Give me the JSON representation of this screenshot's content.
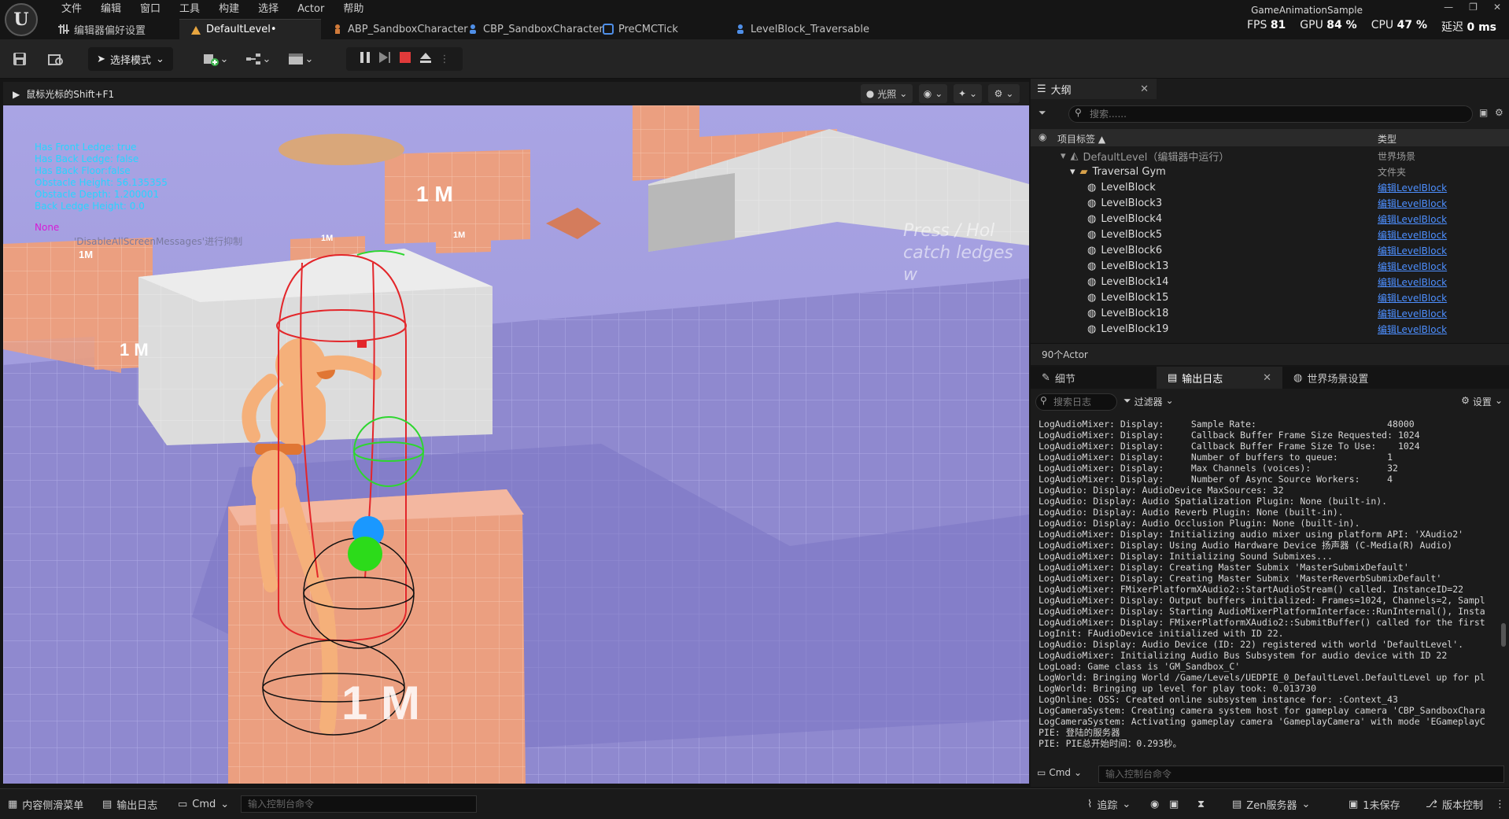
{
  "app": {
    "project_name": "GameAnimationSample"
  },
  "menu": [
    "文件",
    "编辑",
    "窗口",
    "工具",
    "构建",
    "选择",
    "Actor",
    "帮助"
  ],
  "tabs": [
    {
      "label": "编辑器偏好设置",
      "icon": "sliders-icon"
    },
    {
      "label": "DefaultLevel•",
      "icon": "level-icon",
      "active": true
    },
    {
      "label": "ABP_SandboxCharacter",
      "icon": "anim-blueprint-icon"
    },
    {
      "label": "CBP_SandboxCharacter",
      "icon": "character-icon"
    },
    {
      "label": "PreCMCTick",
      "icon": "blueprint-icon"
    },
    {
      "label": "LevelBlock_Traversable",
      "icon": "actor-icon"
    }
  ],
  "perf": {
    "fps_label": "FPS",
    "fps": "81",
    "gpu_label": "GPU",
    "gpu": "84 %",
    "cpu_label": "CPU",
    "cpu": "47 %",
    "latency_label": "延迟",
    "latency": "0 ms"
  },
  "toolbar": {
    "mode_label": "选择模式"
  },
  "viewport": {
    "hint": "鼠标光标的Shift+F1",
    "lit_label": "光照",
    "debug_lines": [
      "Has Front Ledge: true",
      "Has Back Ledge: false",
      "Has Back Floor:false",
      "Obstacle Height: 56.135355",
      "Obstacle Depth: 1.200001",
      "Back Ledge Height: 0.0"
    ],
    "none_label": "None",
    "suppress_msg": "'DisableAllScreenMessages'进行抑制",
    "wall_text_1": "Press / Hol",
    "wall_text_2": "catch ledges w",
    "block_label": "1 M",
    "block_label_small": "1M"
  },
  "outliner": {
    "tab_label": "大纲",
    "search_placeholder": "搜索......",
    "col_label": "项目标签 ▲",
    "col_type": "类型",
    "rows": [
      {
        "label": "DefaultLevel（编辑器中运行）",
        "type": "世界场景",
        "indent": 1,
        "kind": "level"
      },
      {
        "label": "Traversal Gym",
        "type": "文件夹",
        "indent": 2,
        "kind": "folder"
      },
      {
        "label": "LevelBlock",
        "type": "编辑LevelBlock",
        "indent": 3,
        "kind": "actor"
      },
      {
        "label": "LevelBlock3",
        "type": "编辑LevelBlock",
        "indent": 3,
        "kind": "actor"
      },
      {
        "label": "LevelBlock4",
        "type": "编辑LevelBlock",
        "indent": 3,
        "kind": "actor"
      },
      {
        "label": "LevelBlock5",
        "type": "编辑LevelBlock",
        "indent": 3,
        "kind": "actor"
      },
      {
        "label": "LevelBlock6",
        "type": "编辑LevelBlock",
        "indent": 3,
        "kind": "actor"
      },
      {
        "label": "LevelBlock13",
        "type": "编辑LevelBlock",
        "indent": 3,
        "kind": "actor"
      },
      {
        "label": "LevelBlock14",
        "type": "编辑LevelBlock",
        "indent": 3,
        "kind": "actor"
      },
      {
        "label": "LevelBlock15",
        "type": "编辑LevelBlock",
        "indent": 3,
        "kind": "actor"
      },
      {
        "label": "LevelBlock18",
        "type": "编辑LevelBlock",
        "indent": 3,
        "kind": "actor"
      },
      {
        "label": "LevelBlock19",
        "type": "编辑LevelBlock",
        "indent": 3,
        "kind": "actor"
      }
    ],
    "actor_count": "90个Actor"
  },
  "lower_tabs": [
    {
      "label": "细节",
      "icon": "pencil-icon"
    },
    {
      "label": "输出日志",
      "icon": "log-icon",
      "active": true
    },
    {
      "label": "世界场景设置",
      "icon": "globe-icon"
    }
  ],
  "log": {
    "search_placeholder": "搜索日志",
    "filters_label": "过滤器",
    "settings_label": "设置",
    "lines": [
      "LogAudioMixer: Display:     Sample Rate:                        48000",
      "LogAudioMixer: Display:     Callback Buffer Frame Size Requested: 1024",
      "LogAudioMixer: Display:     Callback Buffer Frame Size To Use:    1024",
      "LogAudioMixer: Display:     Number of buffers to queue:         1",
      "LogAudioMixer: Display:     Max Channels (voices):              32",
      "LogAudioMixer: Display:     Number of Async Source Workers:     4",
      "LogAudio: Display: AudioDevice MaxSources: 32",
      "LogAudio: Display: Audio Spatialization Plugin: None (built-in).",
      "LogAudio: Display: Audio Reverb Plugin: None (built-in).",
      "LogAudio: Display: Audio Occlusion Plugin: None (built-in).",
      "LogAudioMixer: Display: Initializing audio mixer using platform API: 'XAudio2'",
      "LogAudioMixer: Display: Using Audio Hardware Device 扬声器 (C-Media(R) Audio)",
      "LogAudioMixer: Display: Initializing Sound Submixes...",
      "LogAudioMixer: Display: Creating Master Submix 'MasterSubmixDefault'",
      "LogAudioMixer: Display: Creating Master Submix 'MasterReverbSubmixDefault'",
      "LogAudioMixer: FMixerPlatformXAudio2::StartAudioStream() called. InstanceID=22",
      "LogAudioMixer: Display: Output buffers initialized: Frames=1024, Channels=2, Sampl",
      "LogAudioMixer: Display: Starting AudioMixerPlatformInterface::RunInternal(), Insta",
      "LogAudioMixer: Display: FMixerPlatformXAudio2::SubmitBuffer() called for the first",
      "LogInit: FAudioDevice initialized with ID 22.",
      "LogAudio: Display: Audio Device (ID: 22) registered with world 'DefaultLevel'.",
      "LogAudioMixer: Initializing Audio Bus Subsystem for audio device with ID 22",
      "LogLoad: Game class is 'GM_Sandbox_C'",
      "LogWorld: Bringing World /Game/Levels/UEDPIE_0_DefaultLevel.DefaultLevel up for pl",
      "LogWorld: Bringing up level for play took: 0.013730",
      "LogOnline: OSS: Created online subsystem instance for: :Context_43",
      "LogCameraSystem: Creating camera system host for gameplay camera 'CBP_SandboxChara",
      "LogCameraSystem: Activating gameplay camera 'GameplayCamera' with mode 'EGameplayC",
      "PIE: 登陆的服务器",
      "PIE: PIE总开始时间：0.293秒。"
    ],
    "cmd_label": "Cmd",
    "cmd_placeholder": "输入控制台命令"
  },
  "statusbar": {
    "content_drawer": "内容侧滑菜单",
    "output_log": "输出日志",
    "cmd_label": "Cmd",
    "cmd_placeholder": "输入控制台命令",
    "trace": "追踪",
    "zen": "Zen服务器",
    "unsaved": "1未保存",
    "source_control": "版本控制"
  },
  "colors": {
    "accent_link": "#4d8fff",
    "debug_text": "#28d4ff",
    "debug_none": "#d61bd6",
    "sky": "#9c97d8",
    "block_orange": "#e89a7a"
  }
}
